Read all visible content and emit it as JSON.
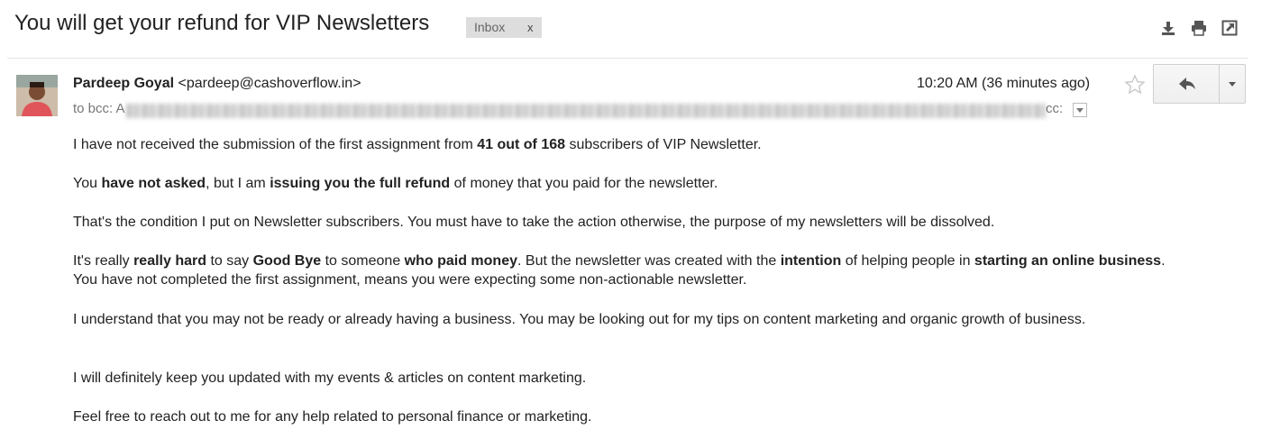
{
  "subject": "You will get your refund for VIP Newsletters",
  "label": {
    "text": "Inbox",
    "remove": "x"
  },
  "toolbar_icons": [
    "download-icon",
    "print-icon",
    "open-in-new-window-icon"
  ],
  "sender": {
    "name": "Pardeep Goyal",
    "email": "<pardeep@cashoverflow.in>"
  },
  "time": "10:20 AM (36 minutes ago)",
  "to_line": {
    "prefix": "to bcc: A",
    "tail": "cc:"
  },
  "body": [
    [
      {
        "t": "I have not received the submission of the first assignment from "
      },
      {
        "b": "41 out of 168"
      },
      {
        "t": " subscribers of VIP Newsletter."
      }
    ],
    [
      {
        "t": "You "
      },
      {
        "b": "have not asked"
      },
      {
        "t": ", but I am "
      },
      {
        "b": "issuing you the full refund"
      },
      {
        "t": " of money that you paid for the newsletter."
      }
    ],
    [
      {
        "t": "That's the condition I put on Newsletter subscribers. You must have to take the action otherwise, the purpose of my newsletters will be dissolved."
      }
    ],
    [
      {
        "t": "It's really "
      },
      {
        "b": "really hard"
      },
      {
        "t": " to say "
      },
      {
        "b": "Good Bye"
      },
      {
        "t": " to someone "
      },
      {
        "b": "who paid money"
      },
      {
        "t": ". But the newsletter was created with the "
      },
      {
        "b": "intention"
      },
      {
        "t": " of helping people in "
      },
      {
        "b": "starting an online business"
      },
      {
        "t": ". You have not completed the first assignment, means you were expecting some non-actionable newsletter."
      }
    ],
    [
      {
        "t": "I understand that you may not be ready or already having a business. You may be looking out for my tips on content marketing and organic growth of business."
      }
    ],
    [
      {
        "t": "I will definitely keep you updated with my events & articles on content marketing."
      }
    ],
    [
      {
        "t": "Feel free to reach out to me for any help related to personal finance or marketing."
      }
    ]
  ]
}
